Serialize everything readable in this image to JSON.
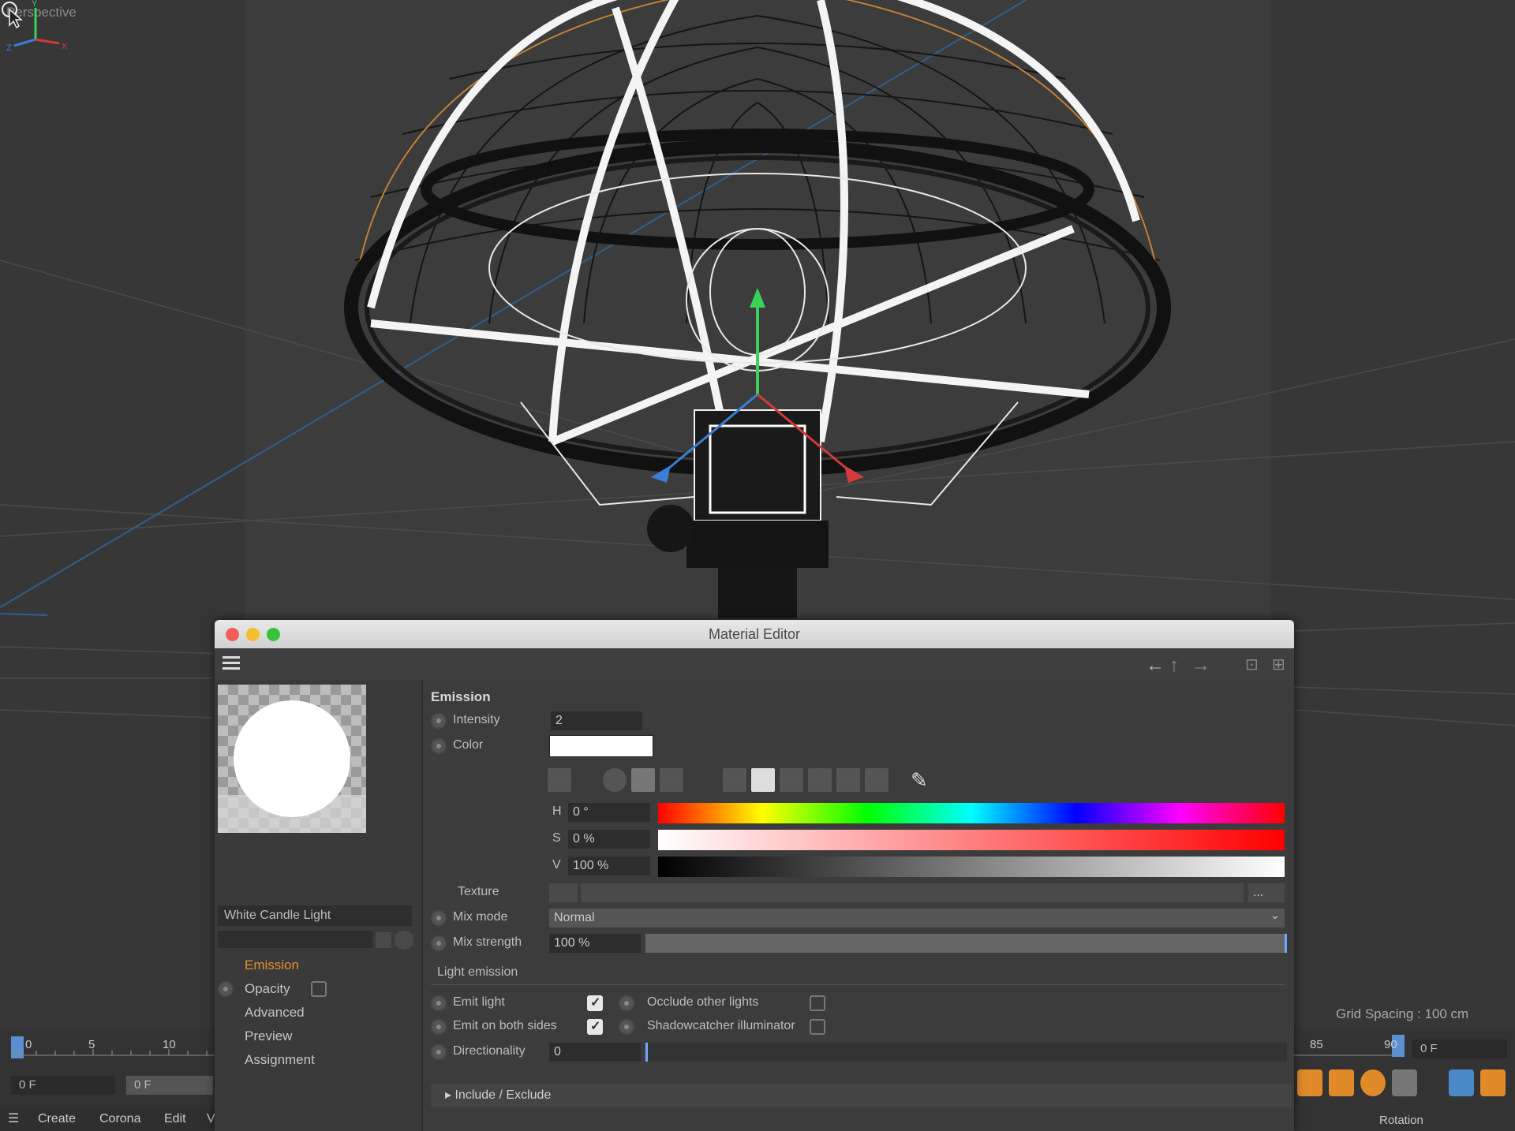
{
  "viewport": {
    "label": "Perspective",
    "grid_spacing": "Grid Spacing : 100 cm"
  },
  "timeline_left": {
    "ticks": [
      "0",
      "5",
      "10"
    ],
    "frame_a": "0 F",
    "frame_b": "0 F"
  },
  "timeline_right": {
    "ticks": [
      "85",
      "90"
    ],
    "frame": "0 F",
    "rotation_label": "Rotation"
  },
  "menu": {
    "items": [
      "Create",
      "Corona",
      "Edit",
      "V"
    ]
  },
  "editor": {
    "title": "Material Editor",
    "material_name": "White Candle Light",
    "channels": [
      {
        "label": "Emission",
        "active": true
      },
      {
        "label": "Opacity",
        "active": false
      },
      {
        "label": "Advanced",
        "active": false
      },
      {
        "label": "Preview",
        "active": false
      },
      {
        "label": "Assignment",
        "active": false
      }
    ],
    "emission": {
      "section_title": "Emission",
      "intensity_label": "Intensity",
      "intensity_value": "2",
      "color_label": "Color",
      "color_value": "#ffffff",
      "h_label": "H",
      "h_value": "0 °",
      "s_label": "S",
      "s_value": "0 %",
      "v_label": "V",
      "v_value": "100 %",
      "texture_label": "Texture",
      "texture_button": "...",
      "mix_mode_label": "Mix mode",
      "mix_mode_value": "Normal",
      "mix_strength_label": "Mix strength",
      "mix_strength_value": "100 %"
    },
    "light_emission": {
      "section_title": "Light emission",
      "emit_light_label": "Emit light",
      "emit_light": true,
      "emit_both_sides_label": "Emit on both sides",
      "emit_both_sides": true,
      "occlude_label": "Occlude other lights",
      "occlude": false,
      "shadowcatcher_label": "Shadowcatcher illuminator",
      "shadowcatcher": false,
      "directionality_label": "Directionality",
      "directionality_value": "0"
    },
    "include_exclude": "Include / Exclude"
  },
  "colors": {
    "accent": "#e0922a",
    "viewport_bg": "#3c3c3c",
    "panel_bg": "#3c3c3c"
  }
}
